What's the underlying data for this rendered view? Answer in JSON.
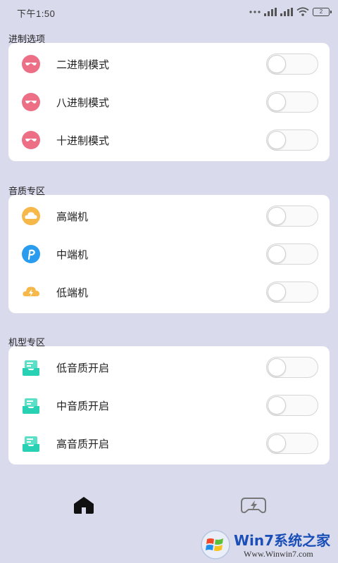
{
  "status_bar": {
    "time": "下午1:50",
    "battery": "2"
  },
  "sections": [
    {
      "title": "进制选项",
      "items": [
        {
          "label": "二进制模式",
          "icon": "pink-glasses-icon",
          "on": false
        },
        {
          "label": "八进制模式",
          "icon": "pink-glasses-icon",
          "on": false
        },
        {
          "label": "十进制模式",
          "icon": "pink-glasses-icon",
          "on": false
        }
      ]
    },
    {
      "title": "音质专区",
      "items": [
        {
          "label": "高端机",
          "icon": "cloud-icon",
          "on": false
        },
        {
          "label": "中端机",
          "icon": "p-logo-icon",
          "on": false
        },
        {
          "label": "低端机",
          "icon": "lightning-cloud-icon",
          "on": false
        }
      ]
    },
    {
      "title": "机型专区",
      "items": [
        {
          "label": "低音质开启",
          "icon": "download-tray-icon",
          "on": false
        },
        {
          "label": "中音质开启",
          "icon": "download-tray-icon",
          "on": false
        },
        {
          "label": "高音质开启",
          "icon": "download-tray-icon",
          "on": false
        }
      ]
    }
  ],
  "bottom_nav": {
    "items": [
      {
        "icon": "home-icon",
        "active": true
      },
      {
        "icon": "gamepad-icon",
        "active": false
      }
    ]
  },
  "watermark": {
    "title": "Win7系统之家",
    "url": "Www.Winwin7.com"
  },
  "colors": {
    "background": "#d9daec",
    "card": "#ffffff",
    "pink": "#ec6f86",
    "cloud_orange": "#f7b84a",
    "blue": "#2a9cf0",
    "teal": "#28d0b4"
  }
}
